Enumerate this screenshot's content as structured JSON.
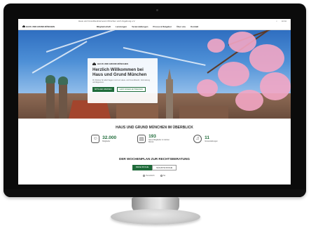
{
  "topbar": {
    "notice": "Haus und Grundbesitzerverein München und Umgebung e.V.",
    "search_icon": "search-icon",
    "lang": "A A A"
  },
  "nav": {
    "brand": "HAUS UND GRUND MÜNCHEN",
    "items": [
      "Mitgliedschaft",
      "Leistungen",
      "Veranstaltungen",
      "Presse & Ratgeber",
      "Über uns",
      "Kontakt"
    ]
  },
  "hero": {
    "card_brand": "HAUS UND GRUND MÜNCHEN",
    "headline_line1": "Herzlich Willkommen bei",
    "headline_line2": "Haus und Grund München",
    "subtext": "Ihr Partner für alle Fragen rund um Haus- und Grundbesitz, Vermietung und Eigentum.",
    "primary_button": "MITGLIED WERDEN",
    "secondary_button": "LEISTUNGEN ENTDECKEN"
  },
  "overview": {
    "title": "HAUS UND GRUND MÜNCHEN IM ÜBERBLICK",
    "stats": [
      {
        "icon": "people-icon",
        "value": "32.000",
        "label": "Mitglieder"
      },
      {
        "icon": "document-icon",
        "value": "193",
        "label": "Neue Mitglieder im letzten Monat"
      },
      {
        "icon": "bell-icon",
        "value": "11",
        "label": "Veranstaltungen"
      }
    ]
  },
  "plan": {
    "title": "DER WOCHENPLAN ZUR RECHTSBERATUNG",
    "tab_active": "DIESE WOCHE",
    "tab_inactive": "NÄCHSTE WOCHE",
    "legend": [
      "Persönlich",
      "Tel."
    ]
  }
}
